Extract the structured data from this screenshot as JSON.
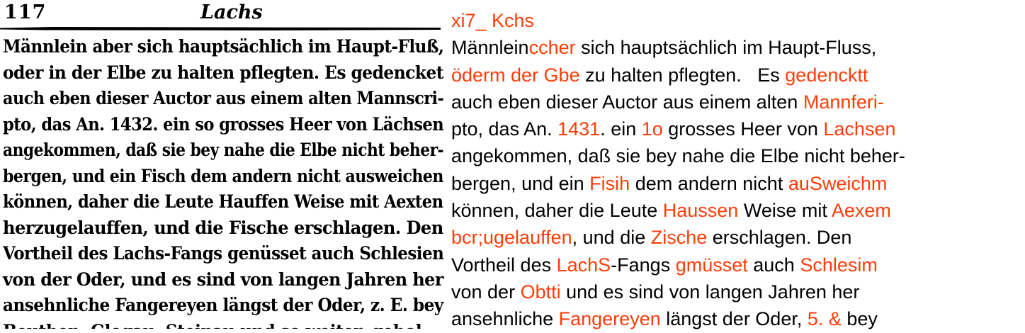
{
  "colors": {
    "error_highlight": "#ff3d0a",
    "normal_text": "#000000",
    "background": "#ffffff"
  },
  "scan": {
    "page_number": "117",
    "running_head": "Lachs",
    "lines": [
      "Männlein aber sich hauptsächlich im Haupt-Fluß,",
      "oder in der Elbe zu halten pflegten.   Es gedencket",
      "auch eben dieser  Auctor aus einem alten Mannscri-",
      "pto, das An. 1432. ein so grosses Heer von Lächsen",
      "angekommen, daß sie bey nahe die Elbe nicht beher-",
      "bergen, und ein Fisch dem andern nicht ausweichen",
      "können, daher die Leute Hauffen Weise mit Aexten",
      "herzugelauffen,  und die Fische erschlagen.  Den",
      "Vortheil des Lachs-Fangs genüsset auch Schlesien",
      "von der Oder,  und es sind von langen Jahren her",
      "ansehnliche Fangereyen längst der Oder, z. E. bey",
      "Beuthen, Glogau, Steinau und so weiter,  geholen"
    ]
  },
  "ocr": {
    "lines": [
      [
        {
          "t": "xi7_ Kchs",
          "e": true
        }
      ],
      [
        {
          "t": "Männlein",
          "e": false
        },
        {
          "t": "ccher",
          "e": true
        },
        {
          "t": " sich hauptsächlich im Haupt-Fluss,",
          "e": false
        }
      ],
      [
        {
          "t": "öderm der Gbe",
          "e": true
        },
        {
          "t": " zu halten pflegten.   Es ",
          "e": false
        },
        {
          "t": "gedencktt",
          "e": true
        }
      ],
      [
        {
          "t": "auch eben dieser Auctor aus einem alten ",
          "e": false
        },
        {
          "t": "Mannferi-",
          "e": true
        }
      ],
      [
        {
          "t": "pto, das An. ",
          "e": false
        },
        {
          "t": "1431",
          "e": true
        },
        {
          "t": ". ein ",
          "e": false
        },
        {
          "t": "1o",
          "e": true
        },
        {
          "t": " grosses Heer von ",
          "e": false
        },
        {
          "t": "Lachsen",
          "e": true
        }
      ],
      [
        {
          "t": "angekommen, daß sie bey nahe die Elbe nicht beher-",
          "e": false
        }
      ],
      [
        {
          "t": "bergen, und ein ",
          "e": false
        },
        {
          "t": "Fisih",
          "e": true
        },
        {
          "t": " dem andern nicht ",
          "e": false
        },
        {
          "t": "auSweichm",
          "e": true
        }
      ],
      [
        {
          "t": "können, daher die Leute ",
          "e": false
        },
        {
          "t": "Haussen",
          "e": true
        },
        {
          "t": " Weise mit ",
          "e": false
        },
        {
          "t": "Aexem",
          "e": true
        }
      ],
      [
        {
          "t": "bcr;ugelauffen",
          "e": true
        },
        {
          "t": ", und die ",
          "e": false
        },
        {
          "t": "Zische",
          "e": true
        },
        {
          "t": " erschlagen. Den",
          "e": false
        }
      ],
      [
        {
          "t": "Vortheil des ",
          "e": false
        },
        {
          "t": "LachS",
          "e": true
        },
        {
          "t": "-Fangs ",
          "e": false
        },
        {
          "t": "gmüsset",
          "e": true
        },
        {
          "t": " auch ",
          "e": false
        },
        {
          "t": "Schlesim",
          "e": true
        }
      ],
      [
        {
          "t": "von der ",
          "e": false
        },
        {
          "t": "Obtti",
          "e": true
        },
        {
          "t": " und es sind von langen Jahren her",
          "e": false
        }
      ],
      [
        {
          "t": "ansehnliche ",
          "e": false
        },
        {
          "t": "Fangereyen",
          "e": true
        },
        {
          "t": " längst der Oder, ",
          "e": false
        },
        {
          "t": "5. &",
          "e": true
        },
        {
          "t": " bey",
          "e": false
        }
      ]
    ]
  }
}
